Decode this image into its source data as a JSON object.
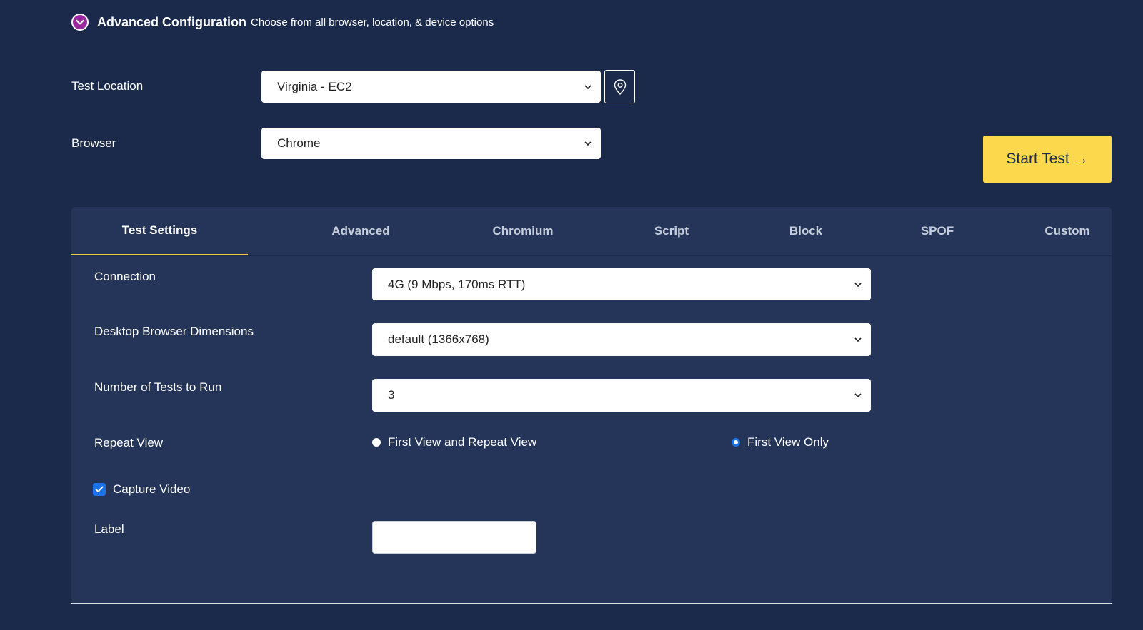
{
  "header": {
    "title": "Advanced Configuration",
    "subtitle": "Choose from all browser, location, & device options"
  },
  "test_location": {
    "label": "Test Location",
    "value": "Virginia - EC2"
  },
  "browser": {
    "label": "Browser",
    "value": "Chrome"
  },
  "start_button": {
    "label": "Start Test →"
  },
  "tabs": [
    {
      "label": "Test Settings",
      "active": true
    },
    {
      "label": "Advanced",
      "active": false
    },
    {
      "label": "Chromium",
      "active": false
    },
    {
      "label": "Script",
      "active": false
    },
    {
      "label": "Block",
      "active": false
    },
    {
      "label": "SPOF",
      "active": false
    },
    {
      "label": "Custom",
      "active": false
    }
  ],
  "settings": {
    "connection": {
      "label": "Connection",
      "value": "4G (9 Mbps, 170ms RTT)"
    },
    "dimensions": {
      "label": "Desktop Browser Dimensions",
      "value": "default (1366x768)"
    },
    "num_tests": {
      "label": "Number of Tests to Run",
      "value": "3"
    },
    "repeat_view": {
      "label": "Repeat View",
      "options": [
        {
          "label": "First View and Repeat View",
          "checked": false
        },
        {
          "label": "First View Only",
          "checked": true
        }
      ]
    },
    "capture_video": {
      "label": "Capture Video",
      "checked": true
    },
    "label_field": {
      "label": "Label",
      "value": ""
    }
  },
  "colors": {
    "background": "#1b2a4b",
    "panel": "#253559",
    "accent_yellow": "#fcd94c",
    "toggle_purple": "#9b2a9f",
    "checkbox_blue": "#1a73e8"
  }
}
